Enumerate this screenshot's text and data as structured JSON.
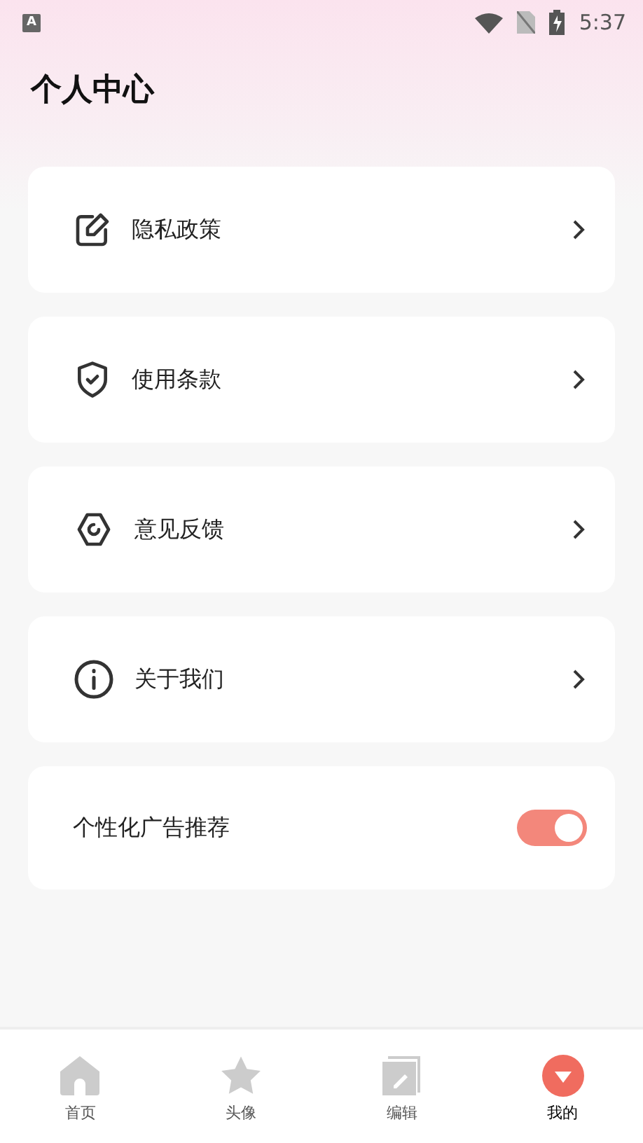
{
  "status_bar": {
    "time": "5:37",
    "badge": "A"
  },
  "title": "个人中心",
  "menu": [
    {
      "kind": "link",
      "label": "隐私政策"
    },
    {
      "kind": "link",
      "label": "使用条款"
    },
    {
      "kind": "link",
      "label": "意见反馈"
    },
    {
      "kind": "link",
      "label": "关于我们"
    },
    {
      "kind": "toggle",
      "label": "个性化广告推荐",
      "on": true
    }
  ],
  "tab_bar": [
    {
      "label": "首页",
      "selected": false
    },
    {
      "label": "头像",
      "selected": false
    },
    {
      "label": "编辑",
      "selected": false
    },
    {
      "label": "我的",
      "selected": true
    }
  ]
}
